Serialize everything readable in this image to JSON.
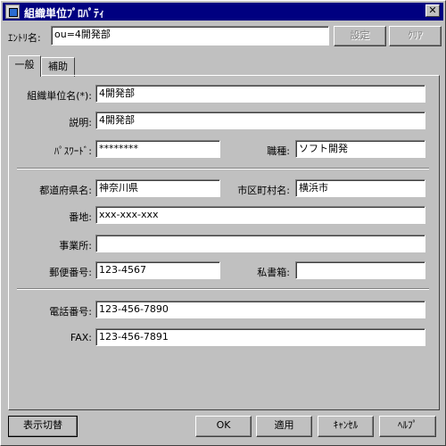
{
  "window": {
    "title": "組織単位ﾌﾟﾛﾊﾟﾃｨ",
    "close_glyph": "✕",
    "icon": "app-icon"
  },
  "entry": {
    "label": "ｴﾝﾄﾘ名:",
    "value": "ou=4開発部",
    "set_button": "設定",
    "clear_button": "ｸﾘｱ"
  },
  "tabs": [
    {
      "label": "一般",
      "active": true
    },
    {
      "label": "補助",
      "active": false
    }
  ],
  "form": {
    "org_unit_name": {
      "label": "組織単位名(*):",
      "value": "4開発部"
    },
    "description": {
      "label": "説明:",
      "value": "4開発部"
    },
    "password": {
      "label": "ﾊﾟｽﾜｰﾄﾞ:",
      "value": "********"
    },
    "job_type": {
      "label": "職種:",
      "value": "ソフト開発"
    },
    "prefecture": {
      "label": "都道府県名:",
      "value": "神奈川県"
    },
    "city": {
      "label": "市区町村名:",
      "value": "横浜市"
    },
    "address": {
      "label": "番地:",
      "value": "xxx-xxx-xxx"
    },
    "office": {
      "label": "事業所:",
      "value": ""
    },
    "postal_code": {
      "label": "郵便番号:",
      "value": "123-4567"
    },
    "po_box": {
      "label": "私書箱:",
      "value": ""
    },
    "phone": {
      "label": "電話番号:",
      "value": "123-456-7890"
    },
    "fax": {
      "label": "FAX:",
      "value": "123-456-7891"
    }
  },
  "buttons": {
    "toggle_view": "表示切替",
    "ok": "OK",
    "apply": "適用",
    "cancel": "ｷｬﾝｾﾙ",
    "help": "ﾍﾙﾌﾟ"
  }
}
